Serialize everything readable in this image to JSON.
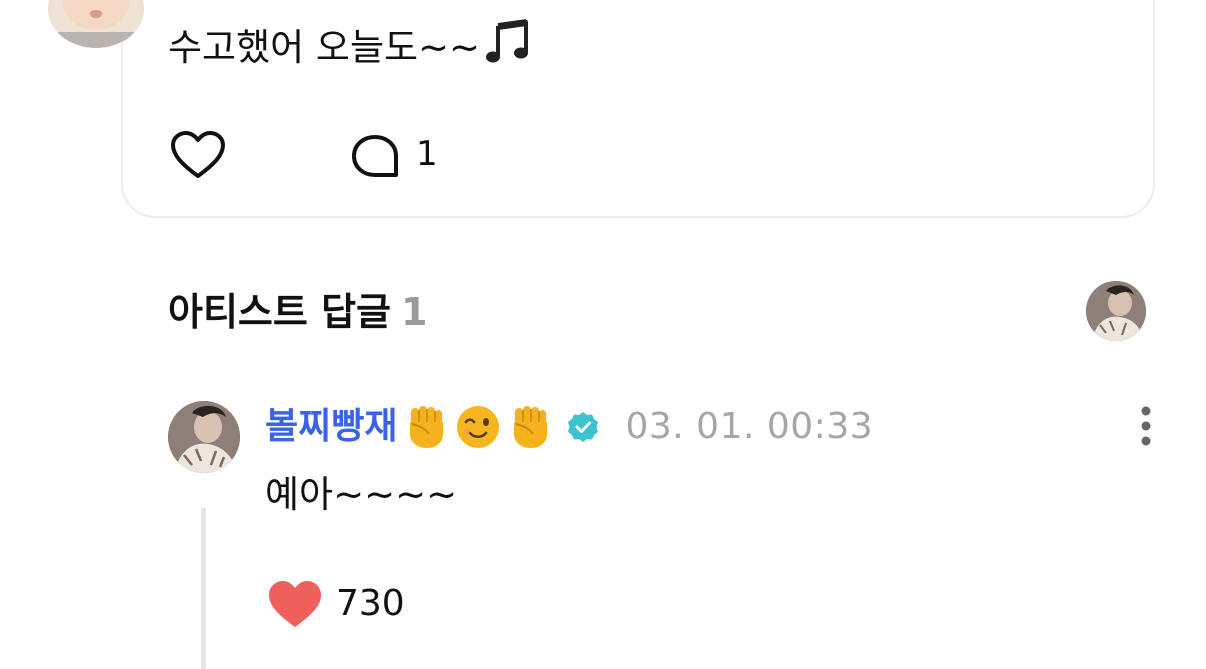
{
  "post": {
    "text": "수고했어 오늘도~~",
    "text_emoji": "music-note",
    "like_icon": "heart-outline-icon",
    "comment_icon": "speech-bubble-icon",
    "comment_count": "1"
  },
  "artist_replies": {
    "title": "아티스트 답글",
    "count": "1"
  },
  "reply": {
    "author": "볼찌빵재",
    "author_emojis": [
      "raised-fist",
      "winking-face",
      "raised-fist"
    ],
    "verified": true,
    "timestamp": "03. 01. 00:33",
    "text": "예아~~~~",
    "likes": "730",
    "liked": true
  },
  "colors": {
    "author_name": "#3a63e8",
    "verified_badge": "#3cc3cf",
    "heart_filled": "#ef5f5c",
    "muted_text": "#a6a6a6",
    "card_border": "#ececec"
  }
}
